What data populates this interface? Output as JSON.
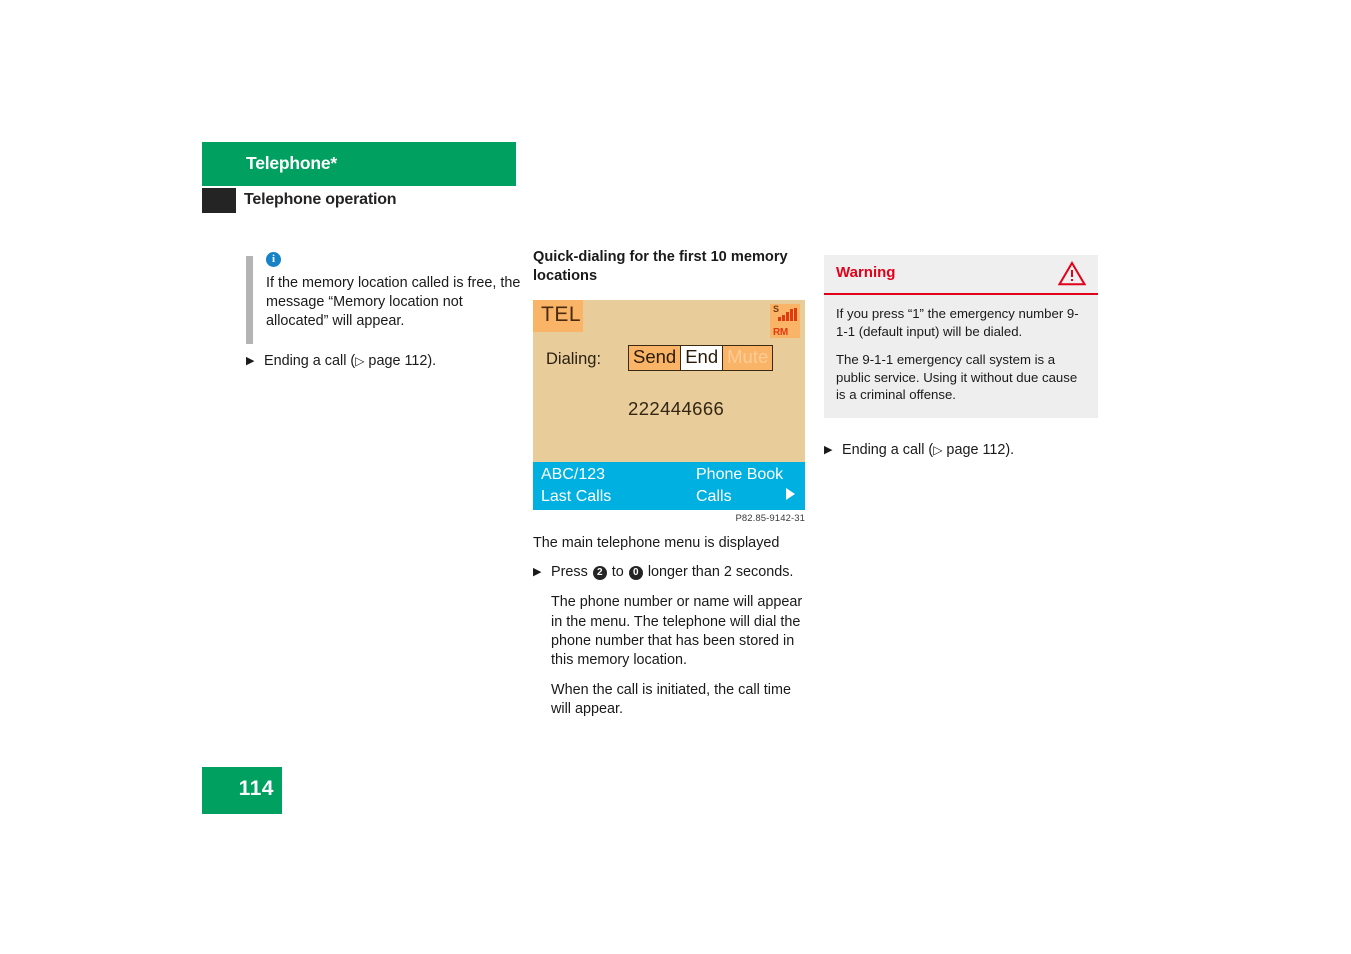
{
  "header": {
    "chapter_title": "Telephone*",
    "section_title": "Telephone operation",
    "chapter_bg": "#00a160",
    "marker_bg": "#242424"
  },
  "left_column": {
    "info_note": {
      "icon": "info-icon",
      "text": "If the memory location called is free, the message “Memory location not allocated” will appear."
    },
    "bullet": {
      "marker": "▶",
      "text_before": "Ending a call (",
      "page_ref_icon": "▷",
      "text_after": " page 112)."
    }
  },
  "middle_column": {
    "heading": "Quick-dialing for the first 10 memory locations",
    "display": {
      "mode_label": "TEL",
      "status_signal": "S",
      "status_roaming": "RM",
      "dialing_label": "Dialing:",
      "softkeys": [
        {
          "label": "Send",
          "state": "normal"
        },
        {
          "label": "End",
          "state": "selected"
        },
        {
          "label": "Mute",
          "state": "disabled"
        }
      ],
      "dialed_number": "222444666",
      "menu": {
        "top_left": "ABC/123",
        "bottom_left": "Last Calls",
        "top_right": "Phone Book",
        "bottom_right": "Calls",
        "arrow": "▶"
      },
      "colors": {
        "screen_bg": "#e8cc9a",
        "badge_bg": "#f9b468",
        "menu_bg": "#00b0e0"
      }
    },
    "figure_caption": "P82.85-9142-31",
    "caption_text": "The main telephone menu is displayed",
    "press_instruction": {
      "marker": "▶",
      "prefix": "Press",
      "key_from": "2",
      "middle": "to",
      "key_to": "0",
      "suffix": "longer than 2 seconds."
    },
    "paragraphs": [
      "The phone number or name will appear in the menu. The telephone will dial the phone number that has been stored in this memory location.",
      "When the call is initiated, the call time will appear."
    ]
  },
  "right_column": {
    "warning": {
      "title": "Warning",
      "icon": "warning-triangle-icon",
      "accent": "#e2001a",
      "paragraphs": [
        "If you press “1” the emergency number 9-1-1 (default input) will be dialed.",
        "The 9-1-1 emergency call system is a public service. Using it without due cause is a criminal offense."
      ]
    },
    "bullet": {
      "marker": "▶",
      "text_before": "Ending a call (",
      "page_ref_icon": "▷",
      "text_after": " page 112)."
    }
  },
  "footer": {
    "page_number": "114",
    "bg": "#00a160"
  }
}
